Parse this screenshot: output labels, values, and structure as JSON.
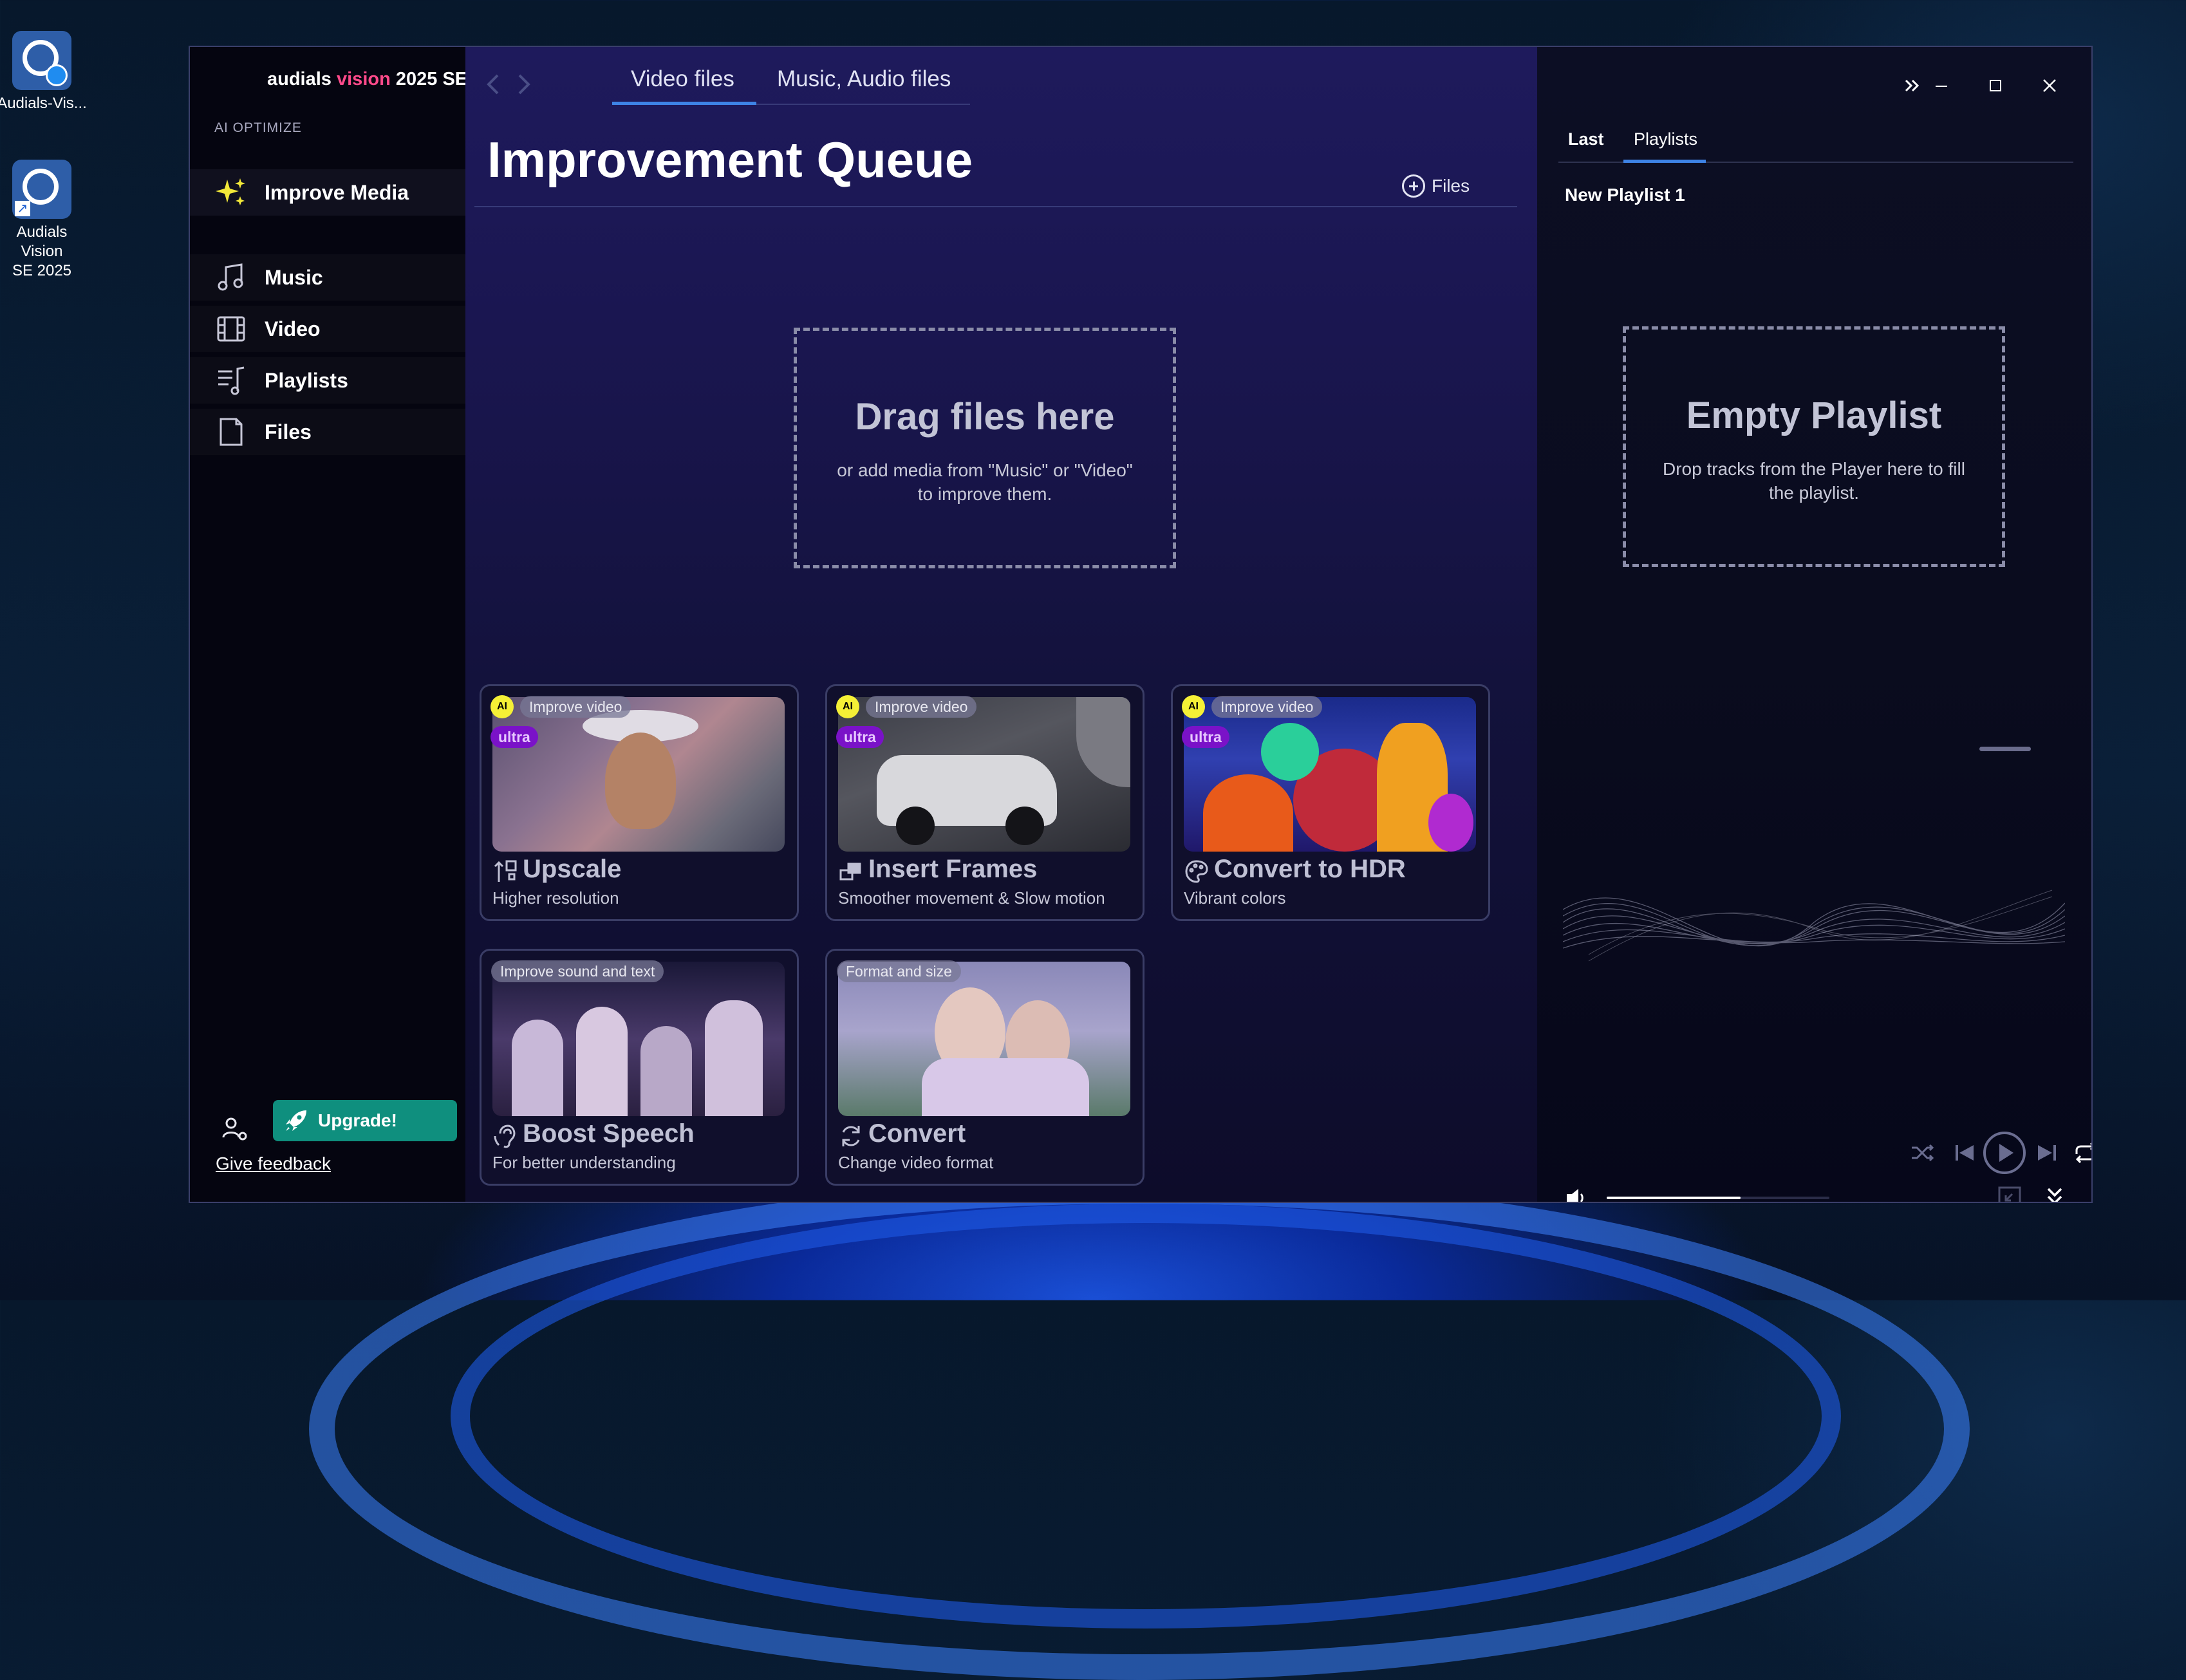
{
  "desktop": {
    "icons": [
      {
        "label_line1": "Audials-Vis...",
        "label_line2": ""
      },
      {
        "label_line1": "Audials Vision",
        "label_line2": "SE 2025"
      }
    ]
  },
  "app": {
    "brand_prefix": "audials ",
    "brand_highlight": "vision",
    "brand_suffix": " 2025 SE"
  },
  "sidebar": {
    "section_label": "AI OPTIMIZE",
    "items": [
      {
        "label": "Improve Media",
        "icon": "sparkle-icon",
        "active": true
      },
      {
        "label": "Music",
        "icon": "music-note-icon"
      },
      {
        "label": "Video",
        "icon": "film-icon"
      },
      {
        "label": "Playlists",
        "icon": "playlist-icon"
      },
      {
        "label": "Files",
        "icon": "file-icon"
      }
    ],
    "upgrade_label": "Upgrade!",
    "feedback_label": "Give feedback"
  },
  "main": {
    "tabs": [
      {
        "label": "Video files",
        "active": true
      },
      {
        "label": "Music, Audio files",
        "active": false
      }
    ],
    "title": "Improvement Queue",
    "add_files_label": "Files",
    "dropzone": {
      "title": "Drag files here",
      "subtitle_line1": "or add media from \"Music\" or \"Video\"",
      "subtitle_line2": "to improve them."
    },
    "cards": [
      {
        "pill": "Improve video",
        "ai": "AI",
        "ultra": "ultra",
        "title": "Upscale",
        "subtitle": "Higher resolution",
        "icon": "upscale-icon"
      },
      {
        "pill": "Improve video",
        "ai": "AI",
        "ultra": "ultra",
        "title": "Insert Frames",
        "subtitle": "Smoother movement & Slow motion",
        "icon": "frames-icon"
      },
      {
        "pill": "Improve video",
        "ai": "AI",
        "ultra": "ultra",
        "title": "Convert to HDR",
        "subtitle": "Vibrant colors",
        "icon": "palette-icon"
      },
      {
        "pill": "Improve sound and text",
        "title": "Boost Speech",
        "subtitle": "For better understanding",
        "icon": "ear-icon"
      },
      {
        "pill": "Format and size",
        "title": "Convert",
        "subtitle": "Change video format",
        "icon": "convert-icon"
      }
    ]
  },
  "right": {
    "tabs": [
      {
        "label": "Last",
        "active": false
      },
      {
        "label": "Playlists",
        "active": true
      }
    ],
    "playlist_name": "New Playlist 1",
    "empty": {
      "title": "Empty Playlist",
      "subtitle_line1": "Drop tracks from the Player here to fill",
      "subtitle_line2": "the playlist."
    },
    "volume_level": 0.6
  },
  "colors": {
    "accent": "#3e83e6",
    "brand_pink": "#ff4a8a",
    "upgrade": "#0f8f7e",
    "ultra": "#7a12c8",
    "ai_badge": "#f5f036"
  }
}
